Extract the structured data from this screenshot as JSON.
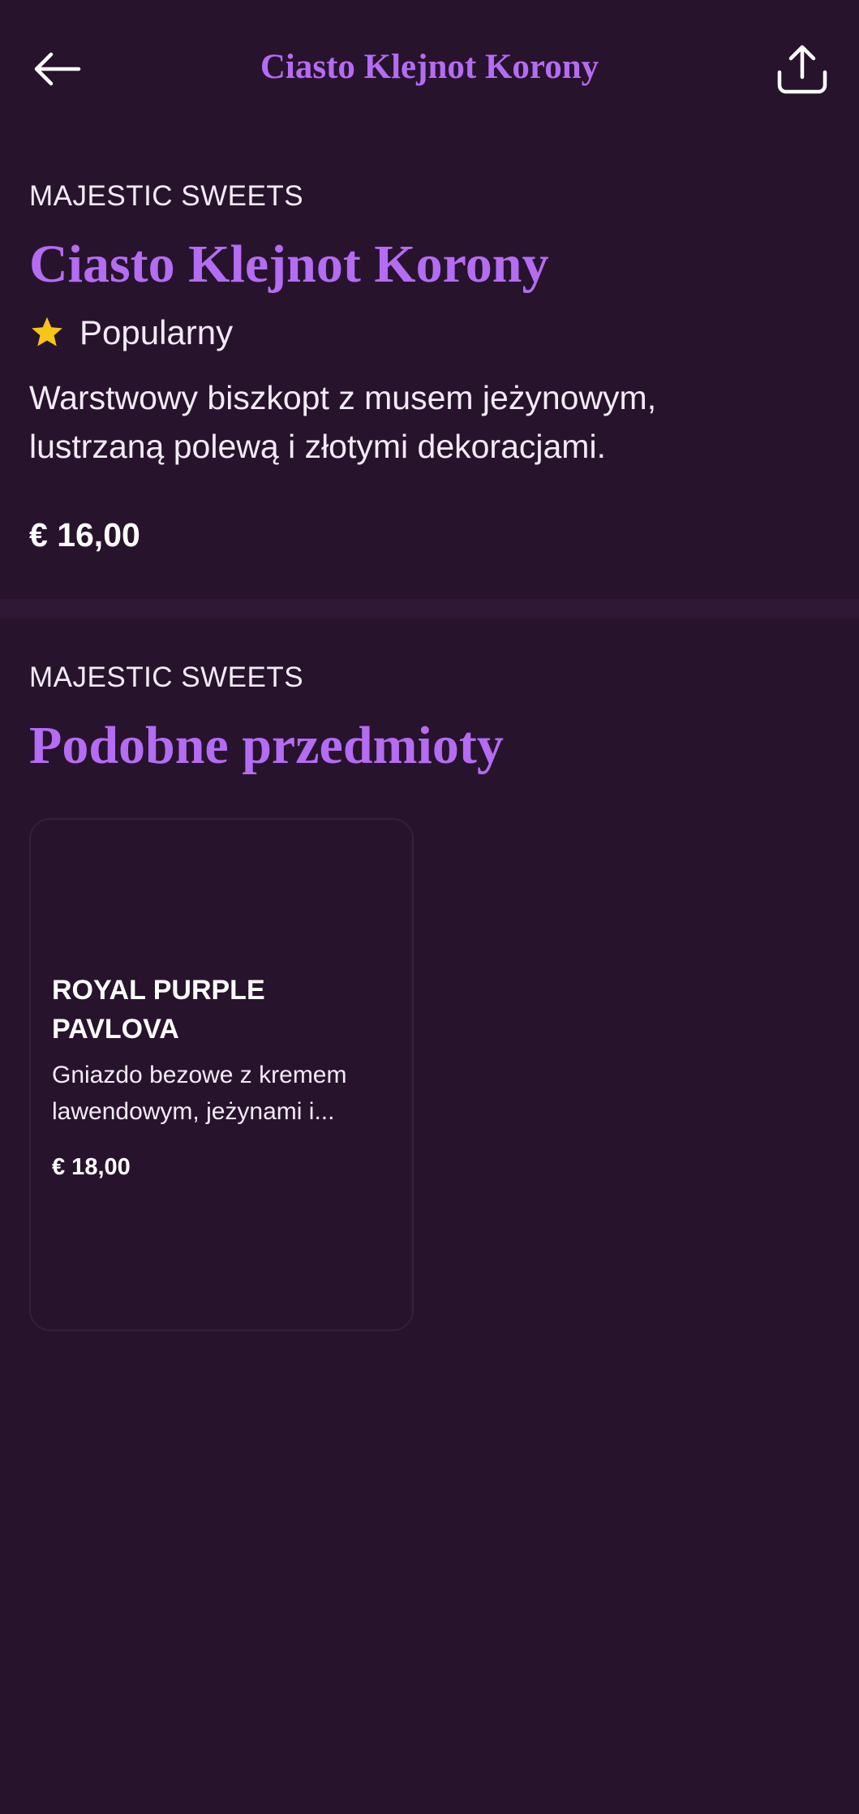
{
  "header": {
    "title": "Ciasto Klejnot Korony",
    "back_icon": "arrow-left-icon",
    "share_icon": "share-icon"
  },
  "product": {
    "brand": "MAJESTIC SWEETS",
    "name": "Ciasto Klejnot Korony",
    "badge": "Popularny",
    "description": "Warstwowy biszkopt z musem jeżynowym, lustrzaną polewą i złotymi dekoracjami.",
    "price": "€ 16,00"
  },
  "similar": {
    "brand": "MAJESTIC SWEETS",
    "title": "Podobne przedmioty",
    "items": [
      {
        "name": "ROYAL PURPLE PAVLOVA",
        "description": "Gniazdo bezowe z kremem lawendowym, jeżynami i...",
        "price": "€ 18,00"
      }
    ]
  },
  "colors": {
    "background": "#28132d",
    "accent": "#b46cf2",
    "star": "#f5c518",
    "text": "#ffffff"
  }
}
